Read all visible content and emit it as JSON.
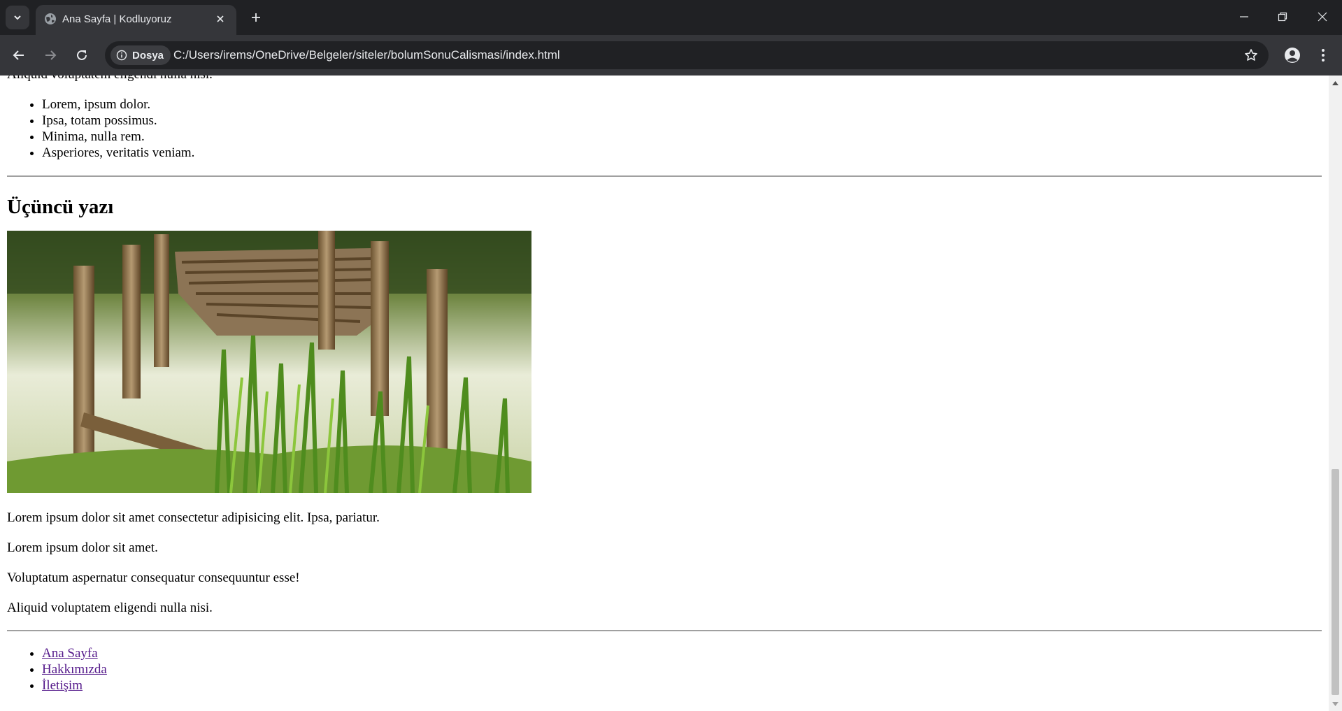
{
  "browser": {
    "tab_title": "Ana Sayfa | Kodluyoruz",
    "security_chip": "Dosya",
    "url": "C:/Users/irems/OneDrive/Belgeler/siteler/bolumSonuCalismasi/index.html",
    "icons": [
      "tab-list-icon",
      "globe-icon",
      "close-icon",
      "plus-icon",
      "minimize-icon",
      "restore-icon",
      "close-window-icon",
      "back-icon",
      "forward-icon",
      "reload-icon",
      "info-icon",
      "star-icon",
      "profile-icon",
      "menu-icon"
    ],
    "colors": {
      "tabbar": "#202124",
      "toolbar": "#35363a",
      "text": "#e8eaed"
    }
  },
  "page": {
    "partial_text": "Aliquid voluptatem eligendi nulla nisi.",
    "list_items": [
      "Lorem, ipsum dolor.",
      "Ipsa, totam possimus.",
      "Minima, nulla rem.",
      "Asperiores, veritatis veniam."
    ],
    "heading": "Üçüncü yazı",
    "image": "wooden-dock-photo",
    "paragraphs": [
      "Lorem ipsum dolor sit amet consectetur adipisicing elit. Ipsa, pariatur.",
      "Lorem ipsum dolor sit amet.",
      "Voluptatum aspernatur consequatur consequuntur esse!",
      "Aliquid voluptatem eligendi nulla nisi."
    ],
    "nav_links": [
      "Ana Sayfa",
      "Hakkımızda",
      "İletişim"
    ],
    "link_color": "#551a8b"
  }
}
